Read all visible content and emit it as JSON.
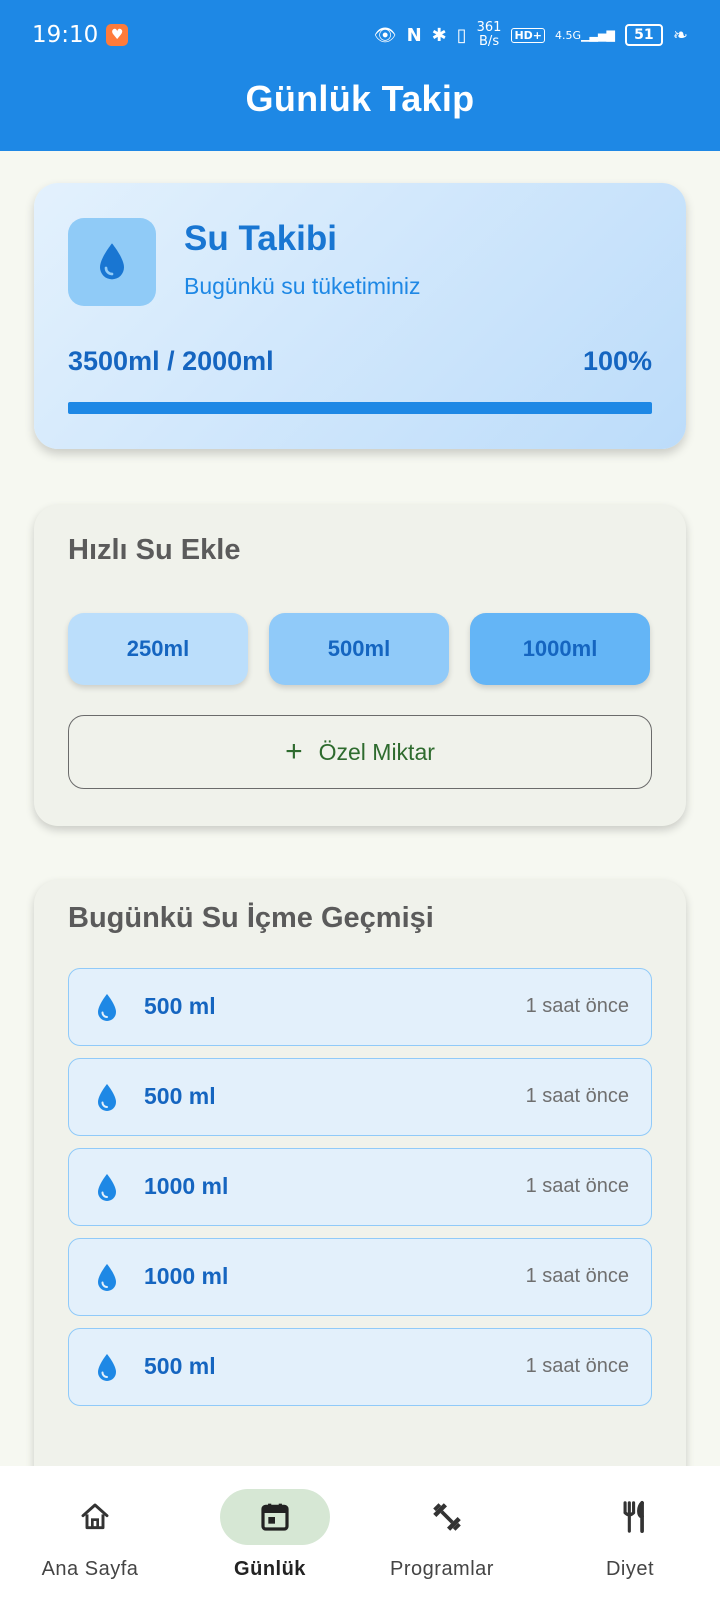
{
  "status_bar": {
    "time": "19:10",
    "net_speed_value": "361",
    "net_speed_unit": "B/s",
    "hd_label": "HD+",
    "network_label": "4.5G",
    "battery": "51"
  },
  "header": {
    "title": "Günlük Takip"
  },
  "water_card": {
    "title": "Su Takibi",
    "subtitle": "Bugünkü su tüketiminiz",
    "amount_text": "3500ml / 2000ml",
    "percent_text": "100%",
    "progress": 1.0
  },
  "quick_add": {
    "title": "Hızlı Su Ekle",
    "buttons": [
      "250ml",
      "500ml",
      "1000ml"
    ],
    "custom_label": "Özel Miktar"
  },
  "history": {
    "title": "Bugünkü Su İçme Geçmişi",
    "items": [
      {
        "amount": "500 ml",
        "time": "1 saat önce"
      },
      {
        "amount": "500 ml",
        "time": "1 saat önce"
      },
      {
        "amount": "1000 ml",
        "time": "1 saat önce"
      },
      {
        "amount": "1000 ml",
        "time": "1 saat önce"
      },
      {
        "amount": "500 ml",
        "time": "1 saat önce"
      }
    ]
  },
  "bottom_nav": {
    "items": [
      {
        "label": "Ana Sayfa",
        "icon": "home-icon"
      },
      {
        "label": "Günlük",
        "icon": "calendar-icon",
        "active": true
      },
      {
        "label": "Programlar",
        "icon": "dumbbell-icon"
      },
      {
        "label": "Diyet",
        "icon": "fork-knife-icon"
      }
    ]
  },
  "colors": {
    "primary": "#1e88e5",
    "dark_blue": "#1565c0",
    "background": "#f6f8f1",
    "active_nav": "#d6e7d4"
  }
}
